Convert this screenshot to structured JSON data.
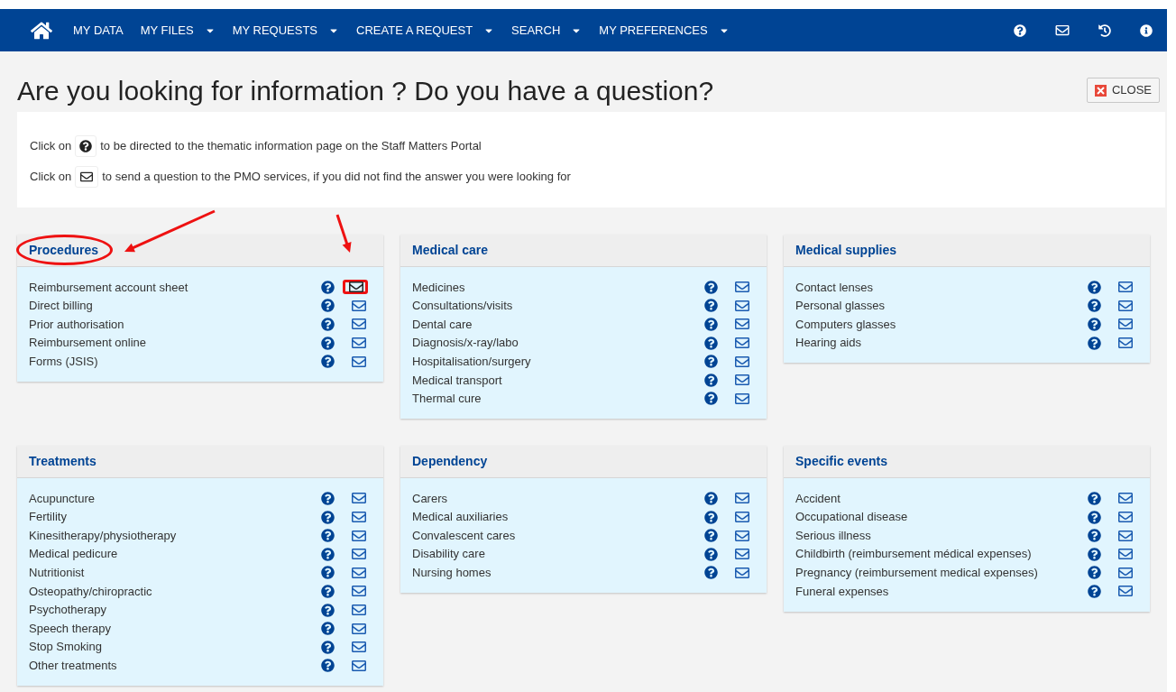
{
  "nav": {
    "items": [
      {
        "label": "MY DATA",
        "dropdown": false
      },
      {
        "label": "MY FILES",
        "dropdown": true
      },
      {
        "label": "MY REQUESTS",
        "dropdown": true
      },
      {
        "label": "CREATE A REQUEST",
        "dropdown": true
      },
      {
        "label": "SEARCH",
        "dropdown": true
      },
      {
        "label": "MY PREFERENCES",
        "dropdown": true
      }
    ]
  },
  "page_title": "Are you looking for information ? Do you have a question?",
  "close_button": "CLOSE",
  "info": {
    "line_1_start": "Click on",
    "line_1_end": "to be directed to the thematic information page on the Staff Matters Portal",
    "line_2_start": "Click on",
    "line_2_end": "to send a question to the PMO services, if you did not find the answer you were looking for"
  },
  "panels": [
    {
      "title": "Procedures",
      "title_marked": true,
      "items": [
        {
          "label": "Reimbursement account sheet",
          "mail_marked": true
        },
        {
          "label": "Direct billing",
          "mail_marked": false
        },
        {
          "label": "Prior authorisation",
          "mail_marked": false
        },
        {
          "label": "Reimbursement online",
          "mail_marked": false
        },
        {
          "label": "Forms (JSIS)",
          "mail_marked": false
        }
      ]
    },
    {
      "title": "Medical care",
      "title_marked": false,
      "items": [
        {
          "label": "Medicines",
          "mail_marked": false
        },
        {
          "label": "Consultations/visits",
          "mail_marked": false
        },
        {
          "label": "Dental care",
          "mail_marked": false
        },
        {
          "label": "Diagnosis/x-ray/labo",
          "mail_marked": false
        },
        {
          "label": "Hospitalisation/surgery",
          "mail_marked": false
        },
        {
          "label": "Medical transport",
          "mail_marked": false
        },
        {
          "label": "Thermal cure",
          "mail_marked": false
        }
      ]
    },
    {
      "title": "Medical supplies",
      "title_marked": false,
      "items": [
        {
          "label": "Contact lenses",
          "mail_marked": false
        },
        {
          "label": "Personal glasses",
          "mail_marked": false
        },
        {
          "label": "Computers glasses",
          "mail_marked": false
        },
        {
          "label": "Hearing aids",
          "mail_marked": false
        }
      ]
    },
    {
      "title": "Treatments",
      "title_marked": false,
      "items": [
        {
          "label": "Acupuncture",
          "mail_marked": false
        },
        {
          "label": "Fertility",
          "mail_marked": false
        },
        {
          "label": "Kinesitherapy/physiotherapy",
          "mail_marked": false
        },
        {
          "label": "Medical pedicure",
          "mail_marked": false
        },
        {
          "label": "Nutritionist",
          "mail_marked": false
        },
        {
          "label": "Osteopathy/chiropractic",
          "mail_marked": false
        },
        {
          "label": "Psychotherapy",
          "mail_marked": false
        },
        {
          "label": "Speech therapy",
          "mail_marked": false
        },
        {
          "label": "Stop Smoking",
          "mail_marked": false
        },
        {
          "label": "Other treatments",
          "mail_marked": false
        }
      ]
    },
    {
      "title": "Dependency",
      "title_marked": false,
      "items": [
        {
          "label": "Carers",
          "mail_marked": false
        },
        {
          "label": "Medical auxiliaries",
          "mail_marked": false
        },
        {
          "label": "Convalescent cares",
          "mail_marked": false
        },
        {
          "label": "Disability care",
          "mail_marked": false
        },
        {
          "label": "Nursing homes",
          "mail_marked": false
        }
      ]
    },
    {
      "title": "Specific events",
      "title_marked": false,
      "items": [
        {
          "label": "Accident",
          "mail_marked": false
        },
        {
          "label": "Occupational disease",
          "mail_marked": false
        },
        {
          "label": "Serious illness",
          "mail_marked": false
        },
        {
          "label": "Childbirth (reimbursement médical expenses)",
          "mail_marked": false
        },
        {
          "label": "Pregnancy (reimbursement medical expenses)",
          "mail_marked": false
        },
        {
          "label": "Funeral expenses",
          "mail_marked": false
        }
      ]
    }
  ]
}
